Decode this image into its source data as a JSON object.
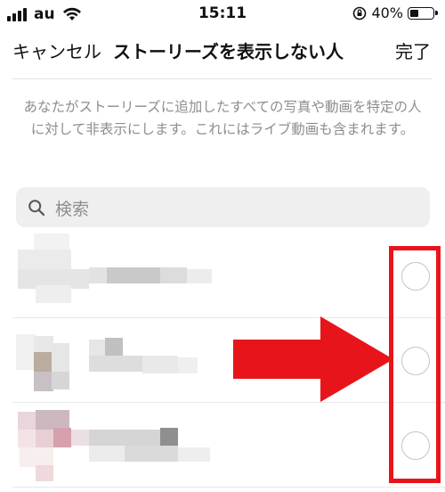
{
  "status_bar": {
    "carrier": "au",
    "time": "15:11",
    "battery": "40%",
    "battery_level": 0.4
  },
  "nav": {
    "cancel_label": "キャンセル",
    "title": "ストーリーズを表示しない人",
    "done_label": "完了"
  },
  "description": "あなたがストーリーズに追加したすべての写真や動画を特定の人に対して非表示にします。これにはライブ動画も含まれます。",
  "search": {
    "placeholder": "検索"
  },
  "rows": [
    {
      "selected": false
    },
    {
      "selected": false
    },
    {
      "selected": false
    }
  ],
  "annotation": {
    "color": "#e8141b"
  }
}
